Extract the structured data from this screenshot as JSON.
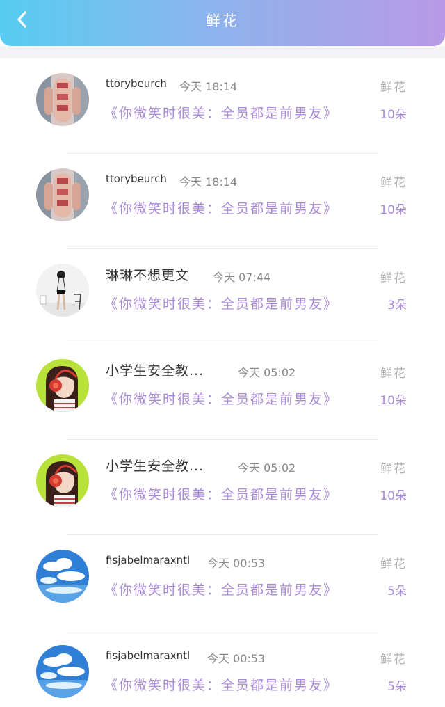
{
  "header": {
    "title": "鲜花",
    "back_icon": "chevron-left-icon",
    "gradient": [
      "#57cdf0",
      "#b99ae6"
    ]
  },
  "colors": {
    "accent": "#a98ad6",
    "muted": "#b0b0b0"
  },
  "records": [
    {
      "username": "ttorybeurch",
      "time": "今天 18:14",
      "gift_label": "鲜花",
      "work_title": "《你微笑时很美：全员都是前男友》",
      "count": "10朵",
      "avatar": "hands-photo"
    },
    {
      "username": "ttorybeurch",
      "time": "今天 18:14",
      "gift_label": "鲜花",
      "work_title": "《你微笑时很美：全员都是前男友》",
      "count": "10朵",
      "avatar": "hands-photo"
    },
    {
      "username": "琳琳不想更文",
      "time": "今天 07:44",
      "gift_label": "鲜花",
      "work_title": "《你微笑时很美：全员都是前男友》",
      "count": "3朵",
      "avatar": "girl-figure"
    },
    {
      "username": "小学生安全教...",
      "time": "今天 05:02",
      "gift_label": "鲜花",
      "work_title": "《你微笑时很美：全员都是前男友》",
      "count": "10朵",
      "avatar": "headphone-girl"
    },
    {
      "username": "小学生安全教...",
      "time": "今天 05:02",
      "gift_label": "鲜花",
      "work_title": "《你微笑时很美：全员都是前男友》",
      "count": "10朵",
      "avatar": "headphone-girl"
    },
    {
      "username": "fisjabelmaraxntl",
      "time": "今天 00:53",
      "gift_label": "鲜花",
      "work_title": "《你微笑时很美：全员都是前男友》",
      "count": "5朵",
      "avatar": "blue-sky"
    },
    {
      "username": "fisjabelmaraxntl",
      "time": "今天 00:53",
      "gift_label": "鲜花",
      "work_title": "《你微笑时很美：全员都是前男友》",
      "count": "5朵",
      "avatar": "blue-sky"
    }
  ]
}
